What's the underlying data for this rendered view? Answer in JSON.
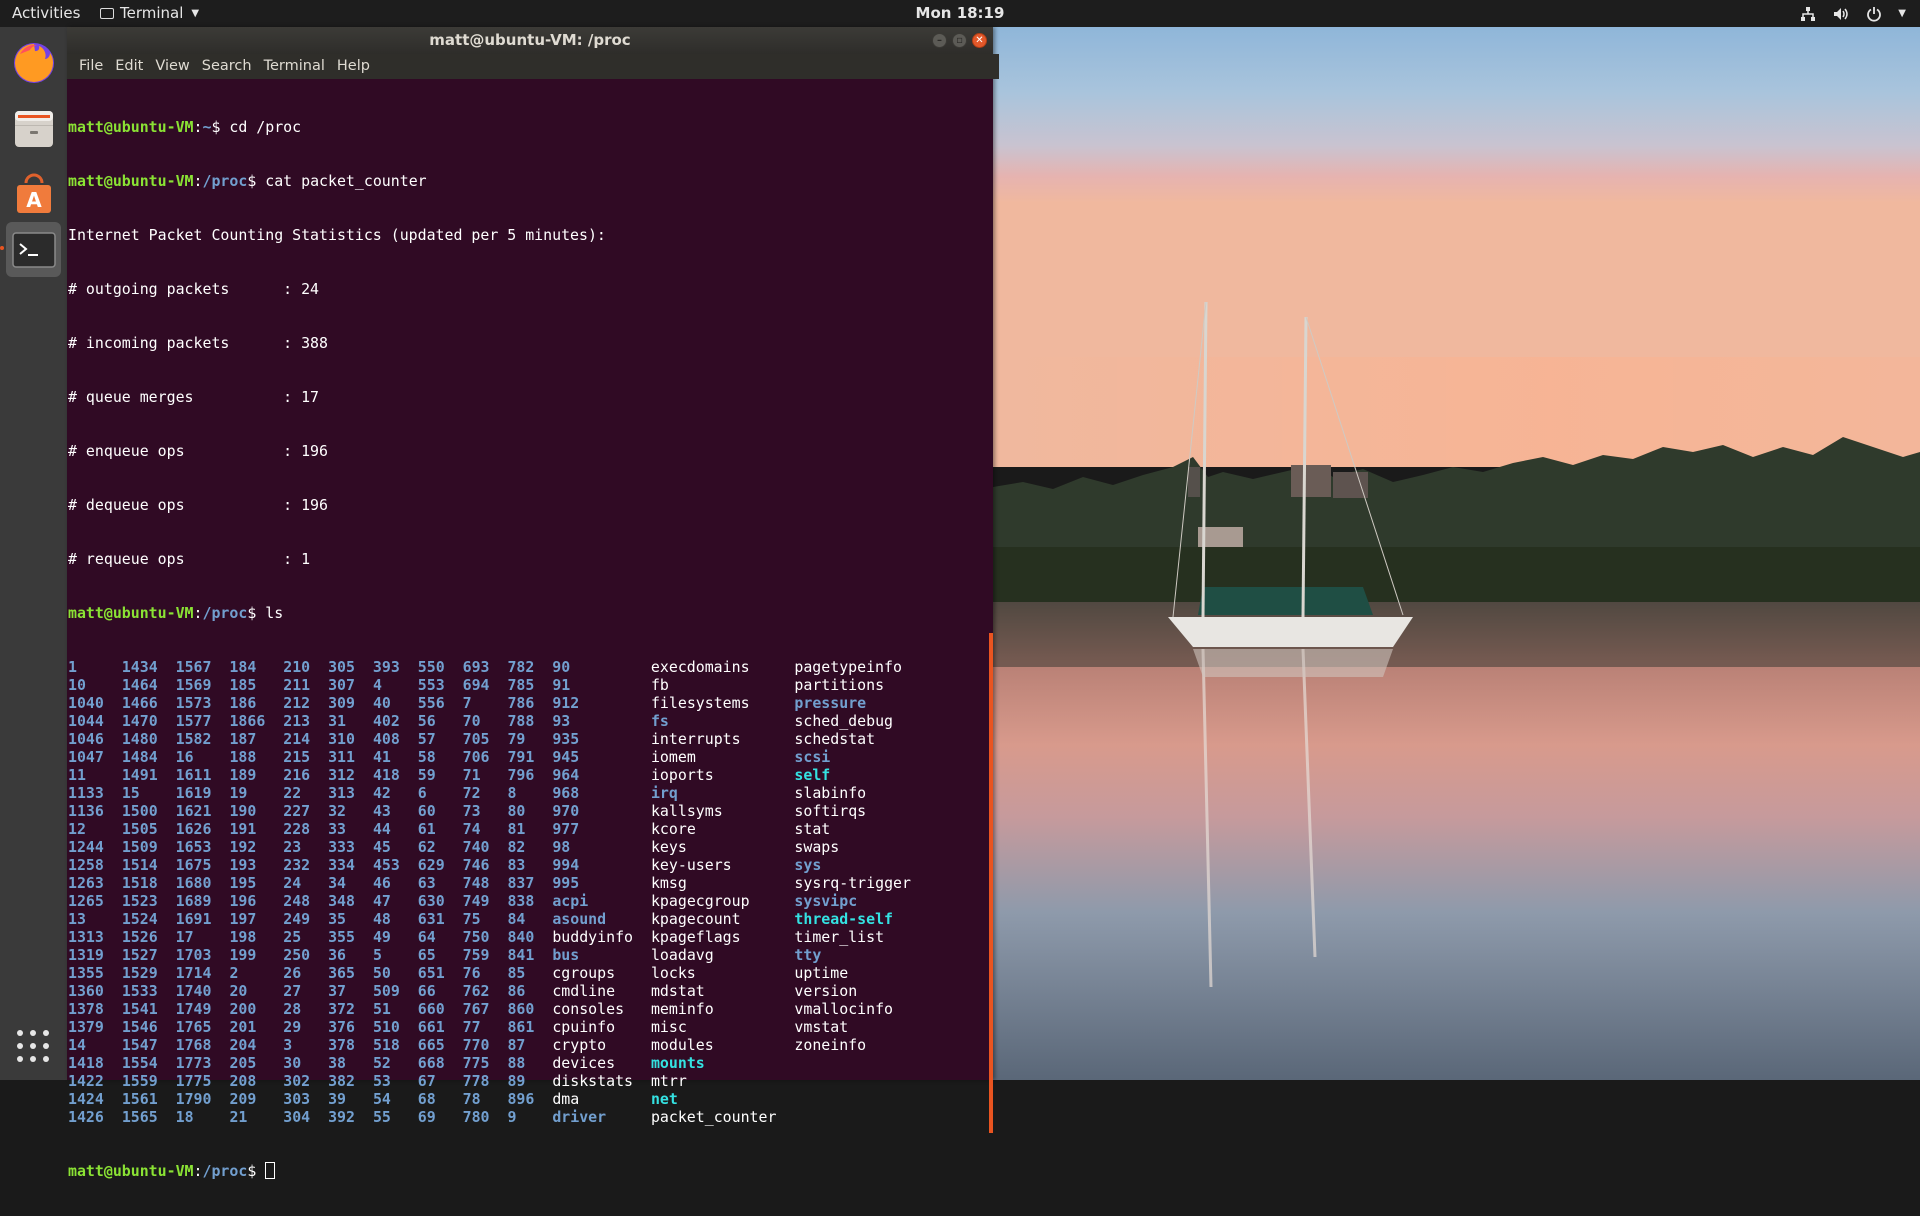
{
  "topbar": {
    "activities": "Activities",
    "app_name": "Terminal",
    "clock": "Mon 18:19",
    "icons": [
      "network-icon",
      "volume-icon",
      "power-icon",
      "chevron-down-icon"
    ]
  },
  "dock": {
    "items": [
      {
        "name": "firefox-icon"
      },
      {
        "name": "files-icon"
      },
      {
        "name": "software-icon"
      },
      {
        "name": "terminal-icon"
      }
    ],
    "show_apps_icon": "show-applications-icon"
  },
  "window": {
    "title": "matt@ubuntu-VM: /proc",
    "menu": [
      "File",
      "Edit",
      "View",
      "Search",
      "Terminal",
      "Help"
    ]
  },
  "terminal": {
    "prompt_user": "matt@ubuntu-VM",
    "session": [
      {
        "path": "~",
        "command": "cd /proc"
      },
      {
        "path": "/proc",
        "command": "cat packet_counter"
      }
    ],
    "output_header": "Internet Packet Counting Statistics (updated per 5 minutes):",
    "stats": [
      {
        "label": "# outgoing packets      :",
        "value": "24"
      },
      {
        "label": "# incoming packets      :",
        "value": "388"
      },
      {
        "label": "# queue merges          :",
        "value": "17"
      },
      {
        "label": "# enqueue ops           :",
        "value": "196"
      },
      {
        "label": "# dequeue ops           :",
        "value": "196"
      },
      {
        "label": "# requeue ops           :",
        "value": "1"
      }
    ],
    "ls_prompt": {
      "path": "/proc",
      "command": "ls"
    },
    "ls_columns": [
      [
        "1",
        "10",
        "1040",
        "1044",
        "1046",
        "1047",
        "11",
        "1133",
        "1136",
        "12",
        "1244",
        "1258",
        "1263",
        "1265",
        "13",
        "1313",
        "1319",
        "1355",
        "1360",
        "1378",
        "1379",
        "14",
        "1418",
        "1422",
        "1424",
        "1426"
      ],
      [
        "1434",
        "1464",
        "1466",
        "1470",
        "1480",
        "1484",
        "1491",
        "15",
        "1500",
        "1505",
        "1509",
        "1514",
        "1518",
        "1523",
        "1524",
        "1526",
        "1527",
        "1529",
        "1533",
        "1541",
        "1546",
        "1547",
        "1554",
        "1559",
        "1561",
        "1565"
      ],
      [
        "1567",
        "1569",
        "1573",
        "1577",
        "1582",
        "16",
        "1611",
        "1619",
        "1621",
        "1626",
        "1653",
        "1675",
        "1680",
        "1689",
        "1691",
        "17",
        "1703",
        "1714",
        "1740",
        "1749",
        "1765",
        "1768",
        "1773",
        "1775",
        "1790",
        "18"
      ],
      [
        "184",
        "185",
        "186",
        "1866",
        "187",
        "188",
        "189",
        "19",
        "190",
        "191",
        "192",
        "193",
        "195",
        "196",
        "197",
        "198",
        "199",
        "2",
        "20",
        "200",
        "201",
        "204",
        "205",
        "208",
        "209",
        "21"
      ],
      [
        "210",
        "211",
        "212",
        "213",
        "214",
        "215",
        "216",
        "22",
        "227",
        "228",
        "23",
        "232",
        "24",
        "248",
        "249",
        "25",
        "250",
        "26",
        "27",
        "28",
        "29",
        "3",
        "30",
        "302",
        "303",
        "304"
      ],
      [
        "305",
        "307",
        "309",
        "31",
        "310",
        "311",
        "312",
        "313",
        "32",
        "33",
        "333",
        "334",
        "34",
        "348",
        "35",
        "355",
        "36",
        "365",
        "37",
        "372",
        "376",
        "378",
        "38",
        "382",
        "39",
        "392"
      ],
      [
        "393",
        "4",
        "40",
        "402",
        "408",
        "41",
        "418",
        "42",
        "43",
        "44",
        "45",
        "453",
        "46",
        "47",
        "48",
        "49",
        "5",
        "50",
        "509",
        "51",
        "510",
        "518",
        "52",
        "53",
        "54",
        "55"
      ],
      [
        "550",
        "553",
        "556",
        "56",
        "57",
        "58",
        "59",
        "6",
        "60",
        "61",
        "62",
        "629",
        "63",
        "630",
        "631",
        "64",
        "65",
        "651",
        "66",
        "660",
        "661",
        "665",
        "668",
        "67",
        "68",
        "69"
      ],
      [
        "693",
        "694",
        "7",
        "70",
        "705",
        "706",
        "71",
        "72",
        "73",
        "74",
        "740",
        "746",
        "748",
        "749",
        "75",
        "750",
        "759",
        "76",
        "762",
        "767",
        "77",
        "770",
        "775",
        "778",
        "78",
        "780"
      ],
      [
        "782",
        "785",
        "786",
        "788",
        "79",
        "791",
        "796",
        "8",
        "80",
        "81",
        "82",
        "83",
        "837",
        "838",
        "84",
        "840",
        "841",
        "85",
        "86",
        "860",
        "861",
        "87",
        "88",
        "89",
        "896",
        "9"
      ],
      [
        "90",
        "91",
        "912",
        "93",
        "935",
        "945",
        "964",
        "968",
        "970",
        "977",
        "98",
        "994",
        "995",
        "acpi",
        "asound",
        "buddyinfo",
        "bus",
        "cgroups",
        "cmdline",
        "consoles",
        "cpuinfo",
        "crypto",
        "devices",
        "diskstats",
        "dma",
        "driver"
      ],
      [
        "execdomains",
        "fb",
        "filesystems",
        "fs",
        "interrupts",
        "iomem",
        "ioports",
        "irq",
        "kallsyms",
        "kcore",
        "keys",
        "key-users",
        "kmsg",
        "kpagecgroup",
        "kpagecount",
        "kpageflags",
        "loadavg",
        "locks",
        "mdstat",
        "meminfo",
        "misc",
        "modules",
        "mounts",
        "mtrr",
        "net",
        "packet_counter"
      ],
      [
        "pagetypeinfo",
        "partitions",
        "pressure",
        "sched_debug",
        "schedstat",
        "scsi",
        "self",
        "slabinfo",
        "softirqs",
        "stat",
        "swaps",
        "sys",
        "sysrq-trigger",
        "sysvipc",
        "thread-self",
        "timer_list",
        "tty",
        "uptime",
        "version",
        "vmallocinfo",
        "vmstat",
        "zoneinfo"
      ]
    ],
    "ls_directories": [
      "acpi",
      "asound",
      "bus",
      "driver",
      "fs",
      "irq",
      "pressure",
      "scsi",
      "sys",
      "sysvipc",
      "tty"
    ],
    "ls_links": [
      "self",
      "thread-self",
      "mounts",
      "net"
    ],
    "final_prompt_path": "/proc",
    "colors": {
      "background": "#300a24",
      "text": "#ffffff",
      "prompt_user": "#8ae234",
      "prompt_path": "#729fcf",
      "directory": "#729fcf",
      "symlink": "#34e2e2",
      "scrollbar_accent": "#e95420"
    }
  }
}
